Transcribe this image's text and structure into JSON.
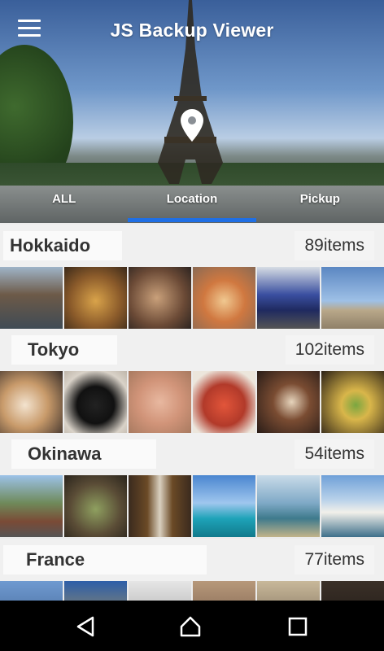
{
  "app": {
    "title": "JS Backup Viewer"
  },
  "tabs": [
    {
      "label": "ALL",
      "selected": false
    },
    {
      "label": "Location",
      "selected": true
    },
    {
      "label": "Pickup",
      "selected": false
    }
  ],
  "colors": {
    "accent": "#1f6fe5",
    "nav_bg": "#000000"
  },
  "sections": [
    {
      "name": "Hokkaido",
      "count": "89items",
      "thumbs": [
        "canal-warehouse-photo",
        "ramen-bowl-photo",
        "seafood-grill-photo",
        "pizza-photo",
        "blue-train-photo",
        "beach-photo"
      ]
    },
    {
      "name": "Tokyo",
      "count": "102items",
      "thumbs": [
        "latte-art-photo",
        "black-cat-photo",
        "manicured-hands-photo",
        "omelette-rice-photo",
        "coffee-cup-photo",
        "christmas-tree-photo"
      ]
    },
    {
      "name": "Okinawa",
      "count": "54items",
      "thumbs": [
        "street-shop-photo",
        "dinner-table-photo",
        "beer-bottles-photo",
        "ocean-bridge-photo",
        "coastline-photo",
        "signboard-photo"
      ]
    },
    {
      "name": "France",
      "count": "77items",
      "thumbs": [
        "street-photo",
        "clock-tower-photo",
        "statue-photo",
        "building-photo",
        "arcade-photo",
        "night-photo"
      ]
    }
  ],
  "nav": {
    "icons": [
      "back-icon",
      "home-icon",
      "recents-icon"
    ]
  }
}
